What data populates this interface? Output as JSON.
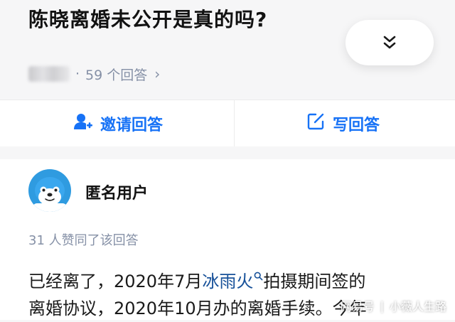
{
  "question": {
    "title": "陈晓离婚未公开是真的吗?",
    "answers_count": "59 个回答",
    "meta_dot": "·",
    "chevron": "›"
  },
  "actions": {
    "invite_label": "邀请回答",
    "write_label": "写回答"
  },
  "answer": {
    "author": "匿名用户",
    "likes_text": "31 人赞同了该回答",
    "line1_before": "已经离了，2020年7月",
    "line1_keyword": "冰雨火",
    "line1_after": "拍摄期间签的",
    "line2": "离婚协议，2020年10月办的离婚手续。今年"
  },
  "watermark": {
    "source": "网易号",
    "separator": "|",
    "author": "小薇人生路"
  },
  "colors": {
    "accent": "#1772f6",
    "muted": "#8590a6",
    "keyword": "#175199"
  }
}
